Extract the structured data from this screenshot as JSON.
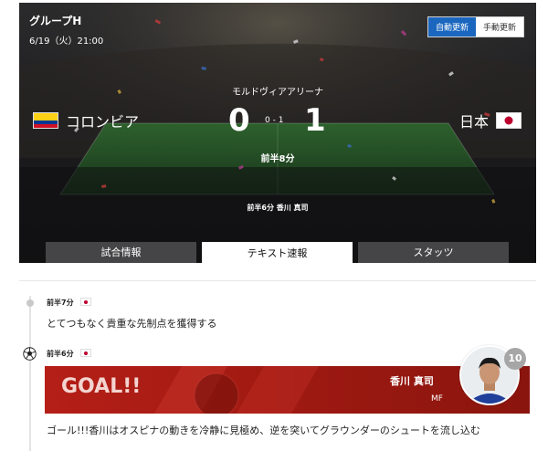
{
  "header": {
    "group_title": "グループH",
    "match_date": "6/19（火）21:00",
    "auto_update_label": "自動更新",
    "manual_update_label": "手動更新"
  },
  "match": {
    "venue": "モルドヴィアアリーナ",
    "home_team": "コロンビア",
    "away_team": "日本",
    "home_score": "0",
    "away_score": "1",
    "pk_score": "0 - 1",
    "match_time": "前半8分",
    "scorer_line": "前半6分 香川 真司"
  },
  "tabs": [
    {
      "label": "試合情報"
    },
    {
      "label": "テキスト速報"
    },
    {
      "label": "スタッツ"
    }
  ],
  "active_tab": "テキスト速報",
  "feed": [
    {
      "time": "前半7分",
      "text": "とてつもなく貴重な先制点を獲得する"
    },
    {
      "time": "前半6分",
      "goal_label": "GOAL!!",
      "player": "香川 真司",
      "position": "MF",
      "number": "10",
      "text": "ゴール!!!香川はオスピナの動きを冷静に見極め、逆を突いてグラウンダーのシュートを流し込む"
    }
  ],
  "colors": {
    "accent_blue": "#1b67bf",
    "goal_red": "#a81c14",
    "japan_red": "#bc002d",
    "colombia_yellow": "#fcd116",
    "colombia_blue": "#003893",
    "colombia_red": "#ce1126"
  },
  "icons": [
    "colombia-flag",
    "japan-flag",
    "soccer-ball-icon",
    "player-photo"
  ]
}
